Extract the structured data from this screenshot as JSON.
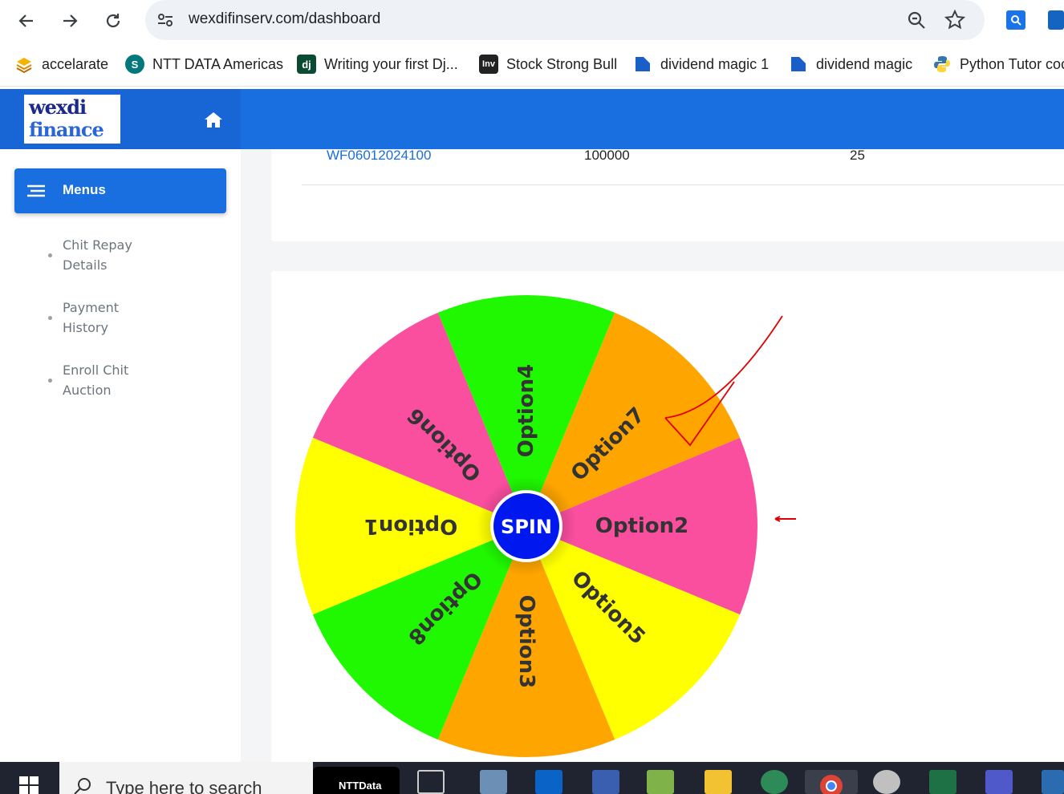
{
  "browser": {
    "url": "wexdifinserv.com/dashboard",
    "bookmarks": [
      {
        "label": "accelarate",
        "icon": "layers-icon"
      },
      {
        "label": "NTT DATA Americas",
        "icon": "sharepoint-icon"
      },
      {
        "label": "Writing your first Dj...",
        "icon": "django-icon"
      },
      {
        "label": "Stock Strong Bull",
        "icon": "investing-icon"
      },
      {
        "label": "dividend magic 1",
        "icon": "document-icon"
      },
      {
        "label": "dividend magic",
        "icon": "document-icon"
      },
      {
        "label": "Python Tutor coc",
        "icon": "python-icon"
      }
    ]
  },
  "app": {
    "logo_line1": "wexdi",
    "logo_line2": "finance"
  },
  "sidebar": {
    "menu_label": "Menus",
    "items": [
      {
        "line1": "Chit Repay",
        "line2": "Details"
      },
      {
        "line1": "Payment",
        "line2": "History"
      },
      {
        "line1": "Enroll Chit",
        "line2": "Auction"
      }
    ]
  },
  "table": {
    "row": {
      "id": "WF06012024100",
      "amount": "100000",
      "count": "25"
    }
  },
  "wheel": {
    "spin_label": "SPIN",
    "segments": [
      {
        "label": "Option2",
        "color": "#fa4e9e"
      },
      {
        "label": "Option5",
        "color": "#ffff00"
      },
      {
        "label": "Option3",
        "color": "#fea500"
      },
      {
        "label": "Option8",
        "color": "#1ff800"
      },
      {
        "label": "Option1",
        "color": "#ffff00"
      },
      {
        "label": "Option6",
        "color": "#fa4e9e"
      },
      {
        "label": "Option4",
        "color": "#1ff800"
      },
      {
        "label": "Option7",
        "color": "#fea500"
      }
    ],
    "hub_color": "#0018f0",
    "label_color": "#333333"
  },
  "taskbar": {
    "search_placeholder": "Type here to search",
    "pinned_label": "NTTData"
  }
}
